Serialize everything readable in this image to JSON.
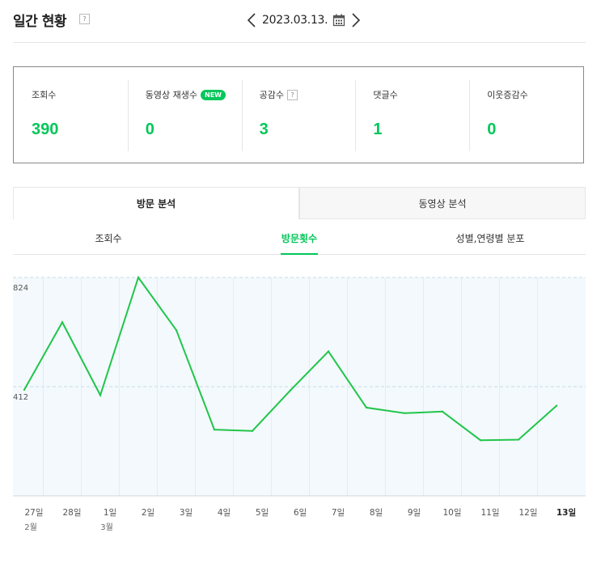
{
  "header": {
    "title": "일간 현황",
    "help": "?",
    "date": "2023.03.13."
  },
  "summary": {
    "stats": [
      {
        "label": "조회수",
        "value": "390"
      },
      {
        "label": "동영상 재생수",
        "badge": "NEW",
        "value": "0"
      },
      {
        "label": "공감수",
        "help": "?",
        "value": "3"
      },
      {
        "label": "댓글수",
        "value": "1"
      },
      {
        "label": "이웃증감수",
        "value": "0"
      }
    ]
  },
  "tabs": [
    {
      "label": "방문 분석",
      "active": true
    },
    {
      "label": "동영상 분석",
      "active": false
    }
  ],
  "subtabs": [
    {
      "label": "조회수",
      "active": false
    },
    {
      "label": "방문횟수",
      "active": true
    },
    {
      "label": "성별,연령별 분포",
      "active": false
    }
  ],
  "colors": {
    "accent": "#03c75a",
    "line": "#21c54a"
  },
  "chart_data": {
    "type": "line",
    "x": [
      "27일",
      "28일",
      "1일",
      "2일",
      "3일",
      "4일",
      "5일",
      "6일",
      "7일",
      "8일",
      "9일",
      "10일",
      "11일",
      "12일",
      "13일"
    ],
    "month_labels": [
      {
        "index": 0,
        "label": "2월"
      },
      {
        "index": 2,
        "label": "3월"
      }
    ],
    "y_ticks": [
      412,
      824
    ],
    "ylim": [
      0,
      824
    ],
    "series": [
      {
        "values": [
          400,
          655,
          380,
          824,
          625,
          250,
          245,
          398,
          545,
          333,
          312,
          318,
          210,
          212,
          340
        ]
      }
    ],
    "grid": "dashed horizontal"
  }
}
